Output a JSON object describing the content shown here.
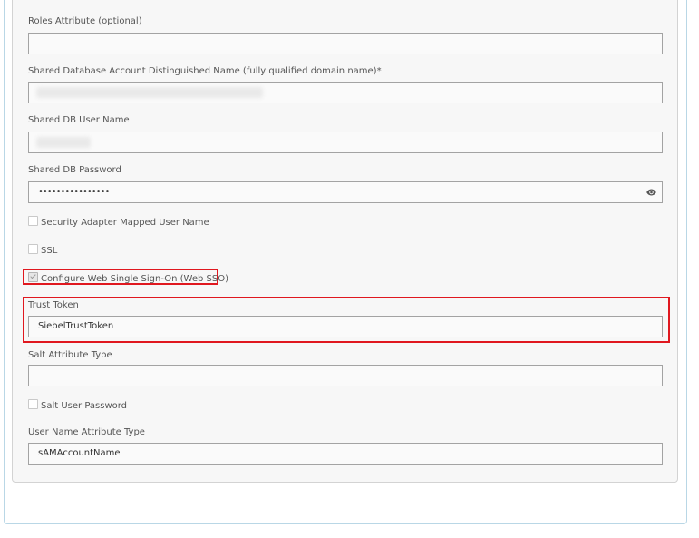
{
  "form": {
    "roles_attribute": {
      "label": "Roles Attribute (optional)",
      "value": ""
    },
    "shared_db_dn": {
      "label": "Shared Database Account Distinguished Name (fully qualified domain name)*"
    },
    "shared_db_user": {
      "label": "Shared DB User Name"
    },
    "shared_db_password": {
      "label": "Shared DB Password",
      "value": "••••••••••••••••",
      "icon": "eye-icon"
    },
    "security_adapter_mapped_user_name": {
      "label": "Security Adapter Mapped User Name",
      "checked": false
    },
    "ssl": {
      "label": "SSL",
      "checked": false
    },
    "web_sso": {
      "label": "Configure Web Single Sign-On (Web SSO)",
      "checked": true
    },
    "trust_token": {
      "label": "Trust Token",
      "value": "SiebelTrustToken"
    },
    "salt_attribute_type": {
      "label": "Salt Attribute Type",
      "value": ""
    },
    "salt_user_password": {
      "label": "Salt User Password",
      "checked": false
    },
    "user_name_attribute_type": {
      "label": "User Name Attribute Type",
      "value": "sAMAccountName"
    }
  },
  "colors": {
    "highlight": "#e0181f",
    "panel_border": "#b9d7e6"
  }
}
